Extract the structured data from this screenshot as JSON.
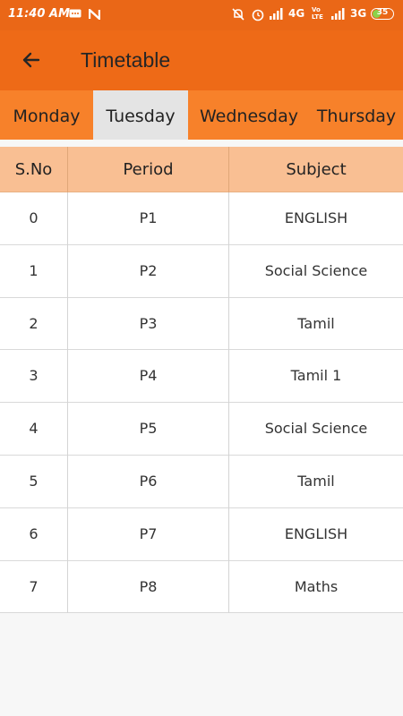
{
  "status_bar": {
    "time": "11:40 AM",
    "network_1": "4G",
    "network_2": "3G",
    "battery": "35",
    "icons": [
      "message-icon",
      "n-app-icon",
      "mute-icon",
      "alarm-icon",
      "signal-icon",
      "volte-icon",
      "battery-icon"
    ]
  },
  "toolbar": {
    "title": "Timetable",
    "back_icon": "arrow-left-icon"
  },
  "tabs": [
    {
      "label": "Monday",
      "selected": false
    },
    {
      "label": "Tuesday",
      "selected": true
    },
    {
      "label": "Wednesday",
      "selected": false
    },
    {
      "label": "Thursday",
      "selected": false
    }
  ],
  "table": {
    "headers": [
      "S.No",
      "Period",
      "Subject"
    ],
    "rows": [
      [
        "0",
        "P1",
        "ENGLISH"
      ],
      [
        "1",
        "P2",
        "Social Science"
      ],
      [
        "2",
        "P3",
        "Tamil"
      ],
      [
        "3",
        "P4",
        "Tamil 1"
      ],
      [
        "4",
        "P5",
        "Social Science"
      ],
      [
        "5",
        "P6",
        "Tamil"
      ],
      [
        "6",
        "P7",
        "ENGLISH"
      ],
      [
        "7",
        "P8",
        "Maths"
      ]
    ]
  },
  "colors": {
    "toolbar": "#ee6a17",
    "tab_bar": "#f7812a",
    "header_row": "#f9bf93",
    "selected_tab": "#e4e4e4"
  }
}
